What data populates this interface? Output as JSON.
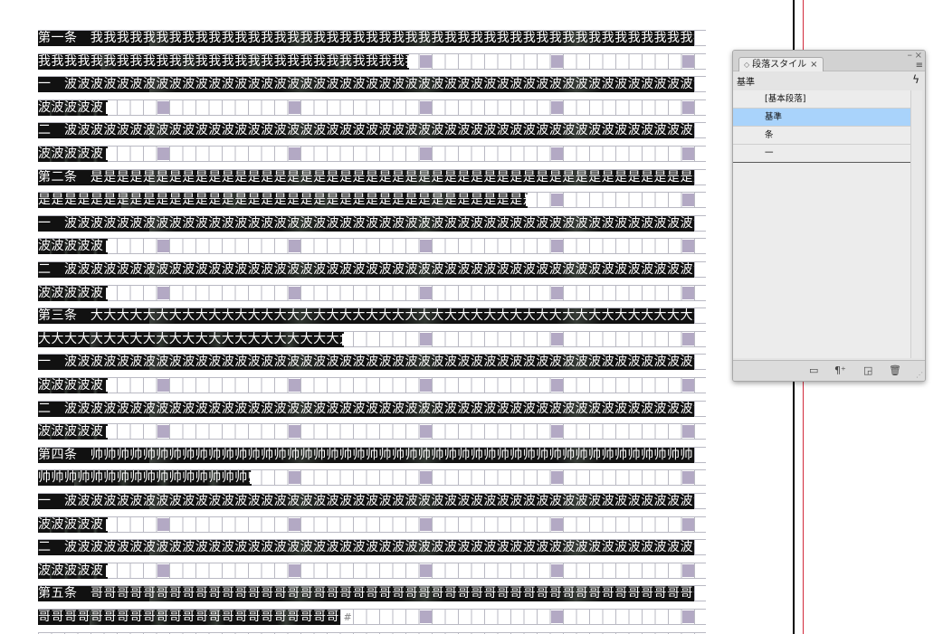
{
  "document": {
    "lines": [
      {
        "text": "第一条　我我我我我我我我我我我我我我我我我我我我我我我我我我我我我我我我我我我我我我我我我我我我我我我",
        "len": 50
      },
      {
        "text": "我我我我我我我我我我我我我我我我我我我我我我我我我我我我我我",
        "len": 28,
        "cursor": true
      },
      {
        "text": "一　波波波波波波波波波波波波波波波波波波波波波波波波波波波波波波波波波波波波波波波波波波波波波波波波波",
        "len": 50
      },
      {
        "text": "波波波波波",
        "len": 5,
        "cursor": true
      },
      {
        "text": "二　波波波波波波波波波波波波波波波波波波波波波波波波波波波波波波波波波波波波波波波波波波波波波波波波波波",
        "len": 50
      },
      {
        "text": "波波波波波",
        "len": 5,
        "cursor": true
      },
      {
        "text": "第二条　是是是是是是是是是是是是是是是是是是是是是是是是是是是是是是是是是是是是是是是是是是是是是是是是是",
        "len": 50
      },
      {
        "text": "是是是是是是是是是是是是是是是是是是是是是是是是是是是是是是是是是是是是是是",
        "len": 37,
        "cursor": true
      },
      {
        "text": "一　波波波波波波波波波波波波波波波波波波波波波波波波波波波波波波波波波波波波波波波波波波波波波波波波波",
        "len": 50
      },
      {
        "text": "波波波波波",
        "len": 5,
        "cursor": true
      },
      {
        "text": "二　波波波波波波波波波波波波波波波波波波波波波波波波波波波波波波波波波波波波波波波波波波波波波波波波波",
        "len": 50
      },
      {
        "text": "波波波波波",
        "len": 5,
        "cursor": true
      },
      {
        "text": "第三条　大大大大大大大大大大大大大大大大大大大大大大大大大大大大大大大大大大大大大大大大大大大大大大大大",
        "len": 50
      },
      {
        "text": "大大大大大大大大大大大大大大大大大大大大大大大大大",
        "len": 23,
        "cursor": true
      },
      {
        "text": "一　波波波波波波波波波波波波波波波波波波波波波波波波波波波波波波波波波波波波波波波波波波波波波波波波波",
        "len": 50
      },
      {
        "text": "波波波波波",
        "len": 5,
        "cursor": true
      },
      {
        "text": "二　波波波波波波波波波波波波波波波波波波波波波波波波波波波波波波波波波波波波波波波波波波波波波波波波波",
        "len": 50
      },
      {
        "text": "波波波波波",
        "len": 5,
        "cursor": true
      },
      {
        "text": "第四条　帅帅帅帅帅帅帅帅帅帅帅帅帅帅帅帅帅帅帅帅帅帅帅帅帅帅帅帅帅帅帅帅帅帅帅帅帅帅帅帅帅帅帅帅帅帅",
        "len": 50
      },
      {
        "text": "帅帅帅帅帅帅帅帅帅帅帅帅帅帅帅帅帅帅帅帅",
        "len": 16,
        "cursor": true
      },
      {
        "text": "一　波波波波波波波波波波波波波波波波波波波波波波波波波波波波波波波波波波波波波波波波波波波波波波波波波",
        "len": 50
      },
      {
        "text": "波波波波波",
        "len": 5,
        "cursor": true
      },
      {
        "text": "二　波波波波波波波波波波波波波波波波波波波波波波波波波波波波波波波波波波波波波波波波波波波波波波波波波",
        "len": 50
      },
      {
        "text": "波波波波波",
        "len": 5,
        "cursor": true
      },
      {
        "text": "第五条　哥哥哥哥哥哥哥哥哥哥哥哥哥哥哥哥哥哥哥哥哥哥哥哥哥哥哥哥哥哥哥哥哥哥哥哥哥哥哥哥哥哥哥哥哥哥哥哥哥哥",
        "len": 50
      },
      {
        "text": "哥哥哥哥哥哥哥哥哥哥哥哥哥哥哥哥哥哥哥哥哥哥哥哥",
        "len": 23,
        "pilcrow": "#"
      },
      {
        "text": "",
        "len": 0
      }
    ]
  },
  "panel": {
    "tab_arrows": "◇",
    "title": "段落スタイル",
    "tab_close": "×",
    "collapse_glyph": "–",
    "close_glyph": "×",
    "menu_glyph": "≡",
    "current_style": "基準",
    "lightning_glyph": "ϟ",
    "styles": [
      "[基本段落]",
      "基準",
      "条",
      "一"
    ],
    "selected_index": 1,
    "footer_icons": [
      "folder-icon",
      "clear-override-icon",
      "new-style-icon",
      "trash-icon"
    ]
  }
}
